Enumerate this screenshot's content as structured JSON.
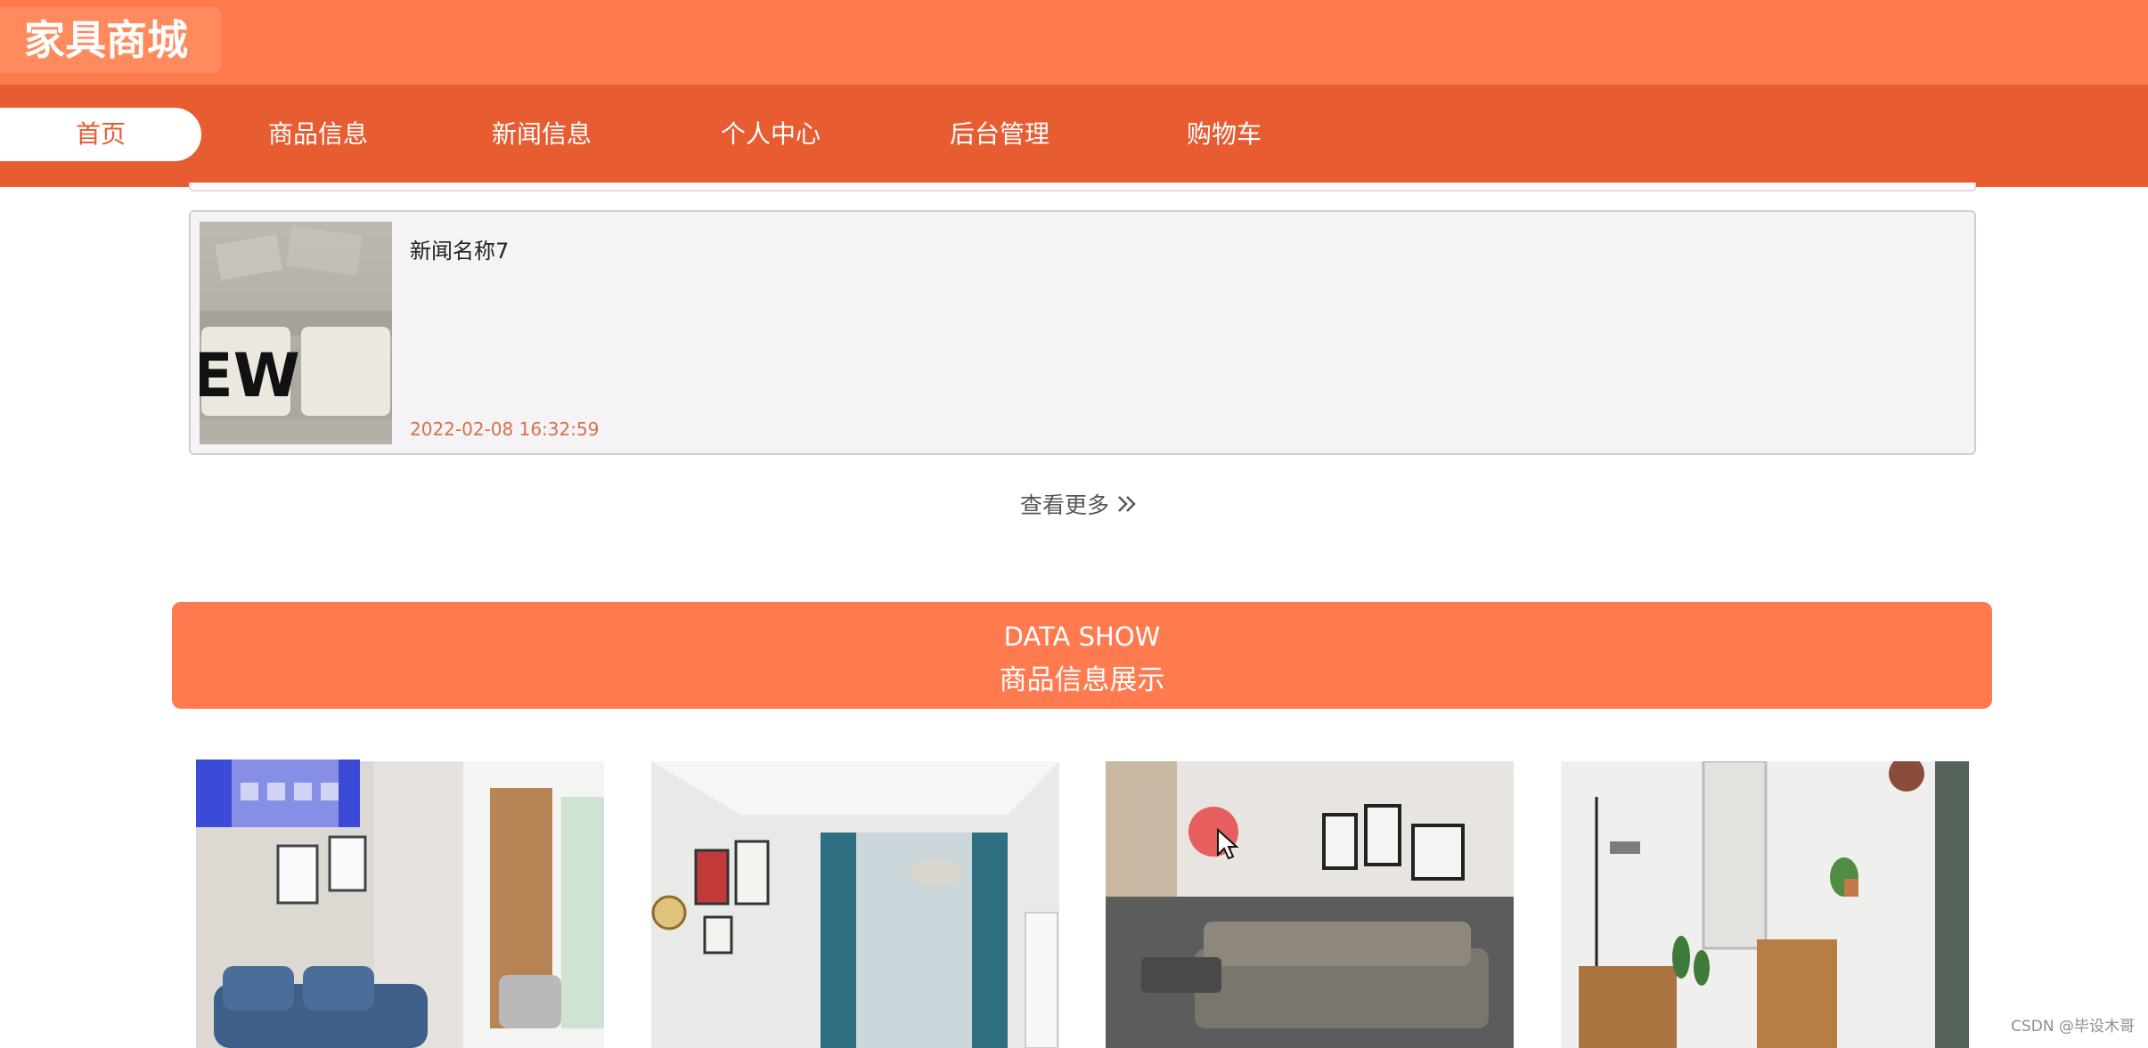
{
  "header": {
    "site_title": "家具商城"
  },
  "nav": {
    "items": [
      {
        "label": "首页",
        "active": true
      },
      {
        "label": "商品信息",
        "active": false
      },
      {
        "label": "新闻信息",
        "active": false
      },
      {
        "label": "个人中心",
        "active": false
      },
      {
        "label": "后台管理",
        "active": false
      },
      {
        "label": "购物车",
        "active": false
      }
    ]
  },
  "news": {
    "items": [
      {
        "thumb_text": "EW",
        "title": "新闻名称7",
        "date": "2022-02-08 16:32:59"
      }
    ],
    "more_label": "查看更多"
  },
  "section": {
    "title_en": "DATA SHOW",
    "title_cn": "商品信息展示"
  },
  "watermark": "CSDN @毕设木哥",
  "colors": {
    "header": "#ff7a4f",
    "nav": "#e85c32",
    "accent_text": "#d4724b",
    "banner": "#ff7a4f"
  },
  "icons": {
    "more": "double-chevron-right-icon",
    "cursor": "mouse-pointer-icon"
  }
}
